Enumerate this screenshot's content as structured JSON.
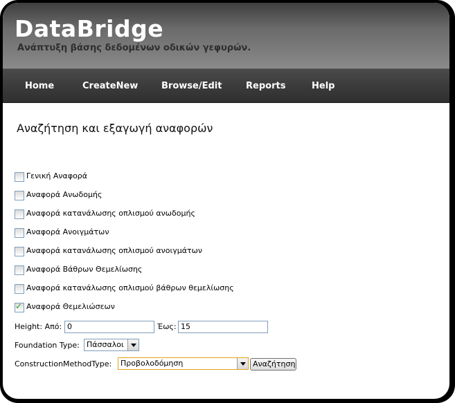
{
  "header": {
    "title": "DataBridge",
    "tagline": "Ανάπτυξη βάσης δεδομένων οδικών γεφυρών."
  },
  "nav": {
    "items": [
      "Home",
      "CreateNew",
      "Browse/Edit",
      "Reports",
      "Help"
    ]
  },
  "main": {
    "heading": "Αναζήτηση και εξαγωγή αναφορών",
    "reports": [
      {
        "label": "Γενική Αναφορά",
        "checked": false
      },
      {
        "label": "Αναφορά Ανωδομής",
        "checked": false
      },
      {
        "label": "Αναφορά κατανάλωσης οπλισμού ανωδομής",
        "checked": false
      },
      {
        "label": "Αναφορά Ανοιγμάτων",
        "checked": false
      },
      {
        "label": "Αναφορά κατανάλωσης οπλισμού ανοιγμάτων",
        "checked": false
      },
      {
        "label": "Αναφορά Βάθρων Θεμελίωσης",
        "checked": false
      },
      {
        "label": "Αναφορά κατανάλωσης οπλισμού βάθρων θεμελίωσης",
        "checked": false
      },
      {
        "label": "Αναφορά Θεμελιώσεων",
        "checked": true
      }
    ],
    "filters": {
      "height_label": "Height: Από:",
      "height_from": "0",
      "height_to_label": "Έως:",
      "height_to": "15",
      "foundation_label": "Foundation Type:",
      "foundation_value": "Πάσσαλοι",
      "construction_label": "ConstructionMethodType:",
      "construction_value": "Προβολοδόμηση",
      "search_button": "Αναζήτηση"
    }
  },
  "colors": {
    "nav_bg": "#3a3a3a",
    "header_bg": "#6a6a6a",
    "focus_border": "#e3a21a",
    "check_color": "#21a121"
  }
}
